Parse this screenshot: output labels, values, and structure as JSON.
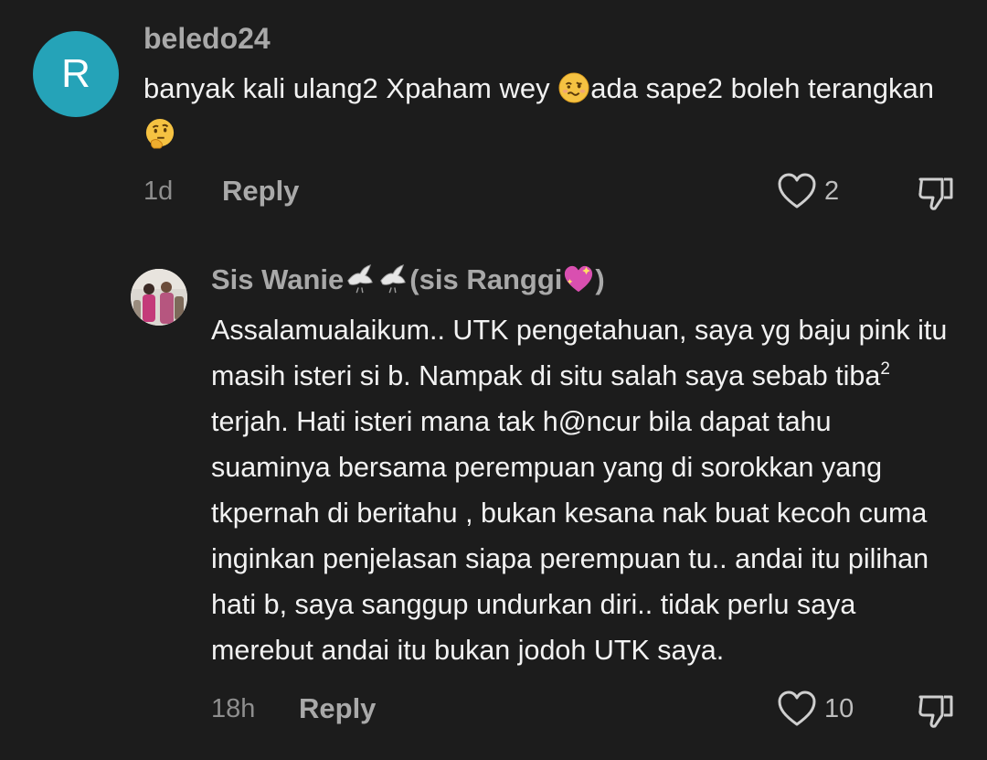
{
  "comments": [
    {
      "avatar_letter": "R",
      "avatar_color": "#25a3b8",
      "username": "beledo24",
      "text_part1": "banyak kali ulang2 Xpaham wey ",
      "emoji1": "woozy-face-emoji",
      "text_part2": "ada sape2 boleh terangkan",
      "emoji2": "thinking-face-emoji",
      "time": "1d",
      "reply_label": "Reply",
      "likes": "2"
    },
    {
      "avatar": "profile-photo",
      "username_part1": "Sis Wanie",
      "username_emoji": "dove-emoji",
      "username_part2": "(sis Ranggi",
      "username_emoji2": "sparkling-heart-emoji",
      "username_part3": ")",
      "text_part1": "Assalamualaikum.. UTK pengetahuan, saya yg baju pink itu masih isteri si b. Nampak di situ salah saya sebab tiba",
      "superscript": "2",
      "text_part2": " terjah. Hati isteri mana tak h@ncur bila dapat tahu suaminya bersama perempuan yang di sorokkan yang tkpernah di beritahu , bukan kesana nak buat kecoh cuma inginkan penjelasan siapa perempuan tu.. andai itu pilihan hati b, saya sanggup undurkan diri.. tidak perlu saya merebut andai itu bukan jodoh UTK saya.",
      "time": "18h",
      "reply_label": "Reply",
      "likes": "10"
    }
  ],
  "colors": {
    "background": "#1c1c1c",
    "username": "#a9a9a9",
    "text": "#f2f2f2",
    "meta": "#8e8e8e"
  }
}
